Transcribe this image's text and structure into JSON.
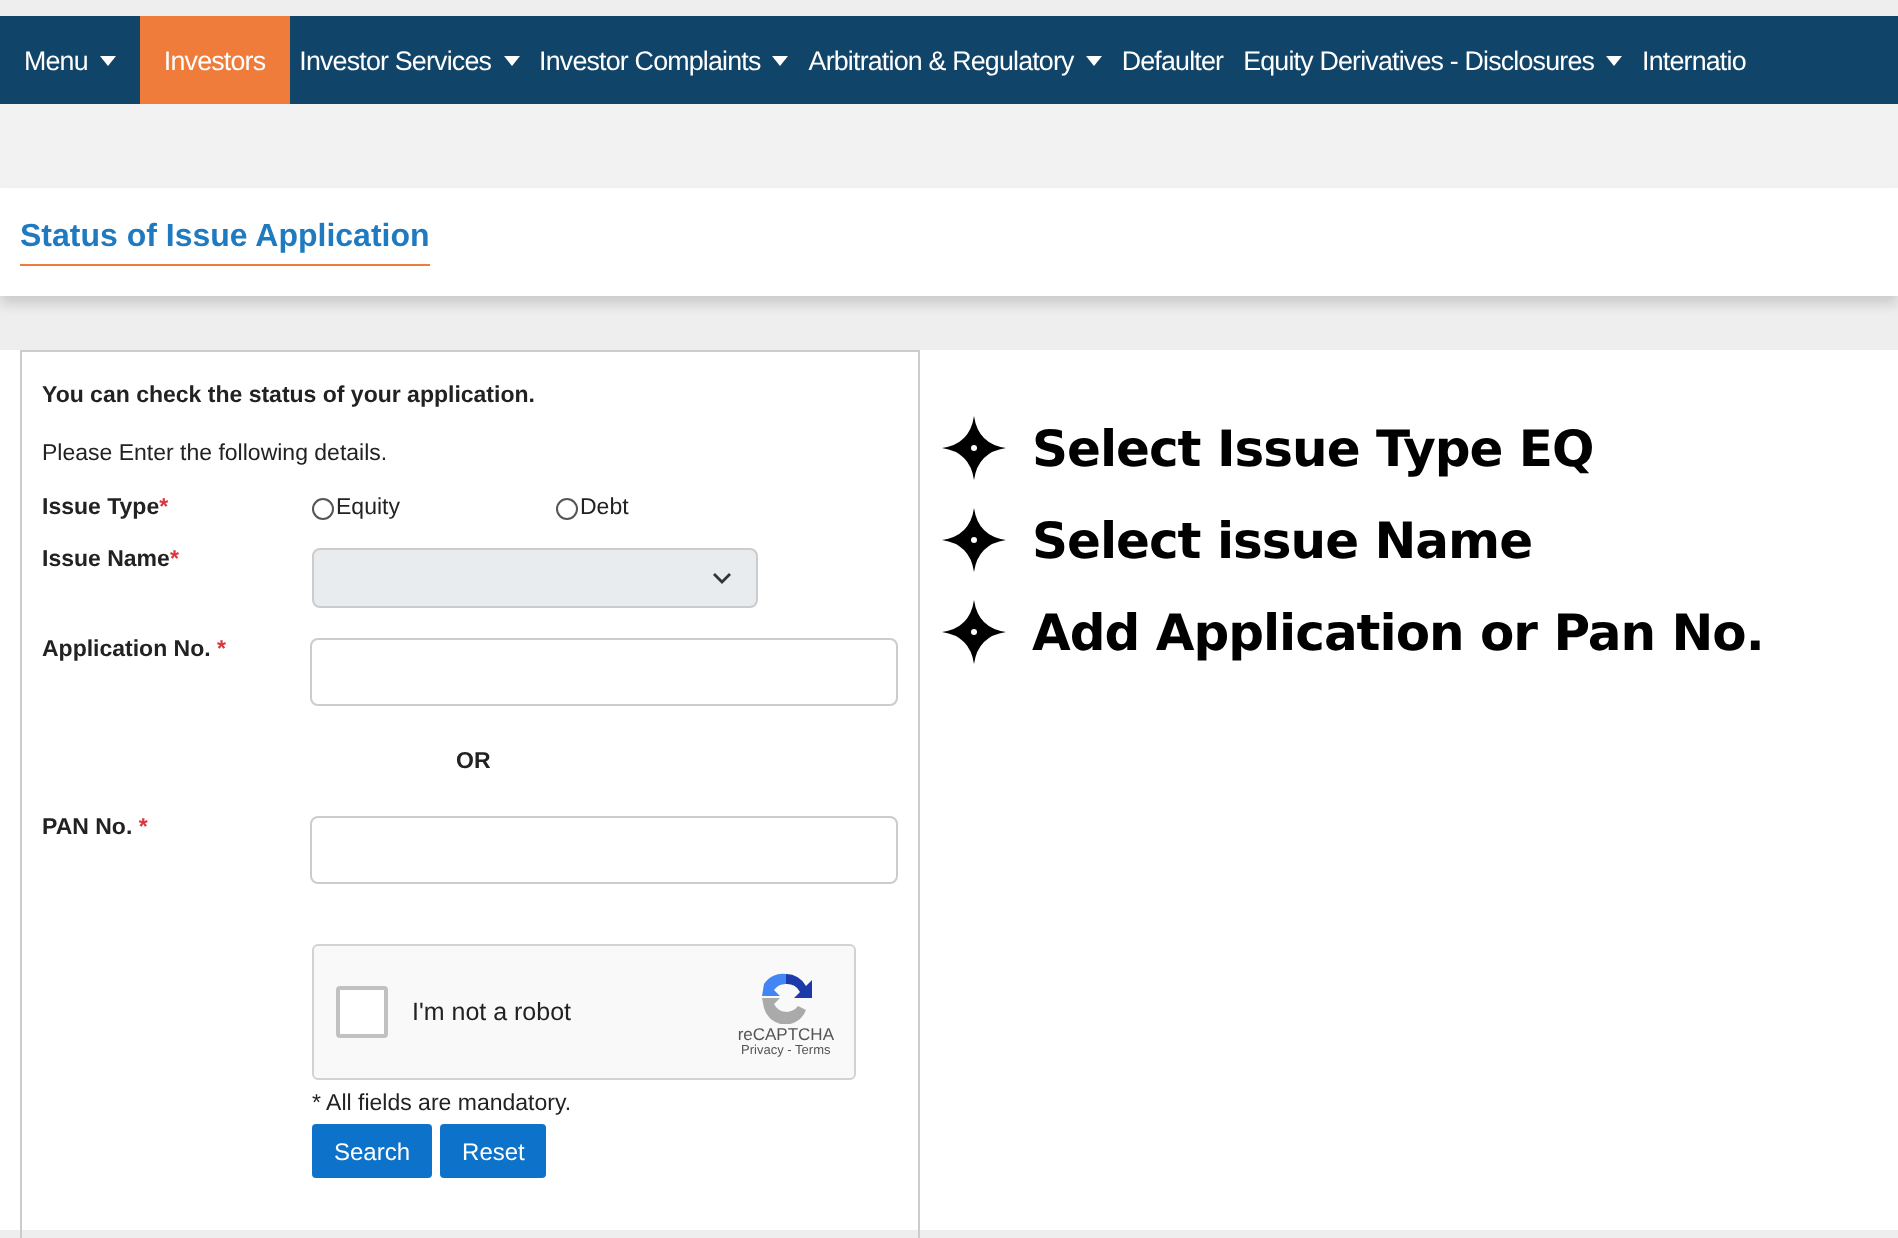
{
  "nav": [
    {
      "label": "Menu",
      "dropdown": true,
      "selected": false
    },
    {
      "label": "Investors",
      "dropdown": false,
      "selected": true
    },
    {
      "label": "Investor Services",
      "dropdown": true,
      "selected": false
    },
    {
      "label": "Investor Complaints",
      "dropdown": true,
      "selected": false
    },
    {
      "label": "Arbitration & Regulatory",
      "dropdown": true,
      "selected": false
    },
    {
      "label": "Defaulter",
      "dropdown": false,
      "selected": false
    },
    {
      "label": "Equity Derivatives - Disclosures",
      "dropdown": true,
      "selected": false
    },
    {
      "label": "Internatio",
      "dropdown": false,
      "selected": false
    }
  ],
  "page_title": "Status of Issue Application",
  "form": {
    "intro": "You can check the status of your application.",
    "instruction": "Please Enter the following details.",
    "required_mark": [
      "*",
      "*",
      "*",
      "*"
    ],
    "issue_type": {
      "label": "Issue Type",
      "options": [
        {
          "label": "Equity",
          "selected": false
        },
        {
          "label": "Debt",
          "selected": false
        }
      ]
    },
    "issue_name": {
      "label": "Issue Name"
    },
    "application_no": {
      "label": "Application No."
    },
    "separator": "OR",
    "pan_no": {
      "label": "PAN No."
    },
    "captcha": {
      "label": "I'm not a robot",
      "checked": false,
      "brand": "reCAPTCHA",
      "privacy": "Privacy",
      "terms": "Terms",
      "dot": "-"
    },
    "note": "* All fields are mandatory.",
    "buttons": [
      "Search",
      "Reset"
    ]
  },
  "annotations": [
    "Select Issue Type EQ",
    "Select issue Name",
    "Add Application or Pan No."
  ]
}
